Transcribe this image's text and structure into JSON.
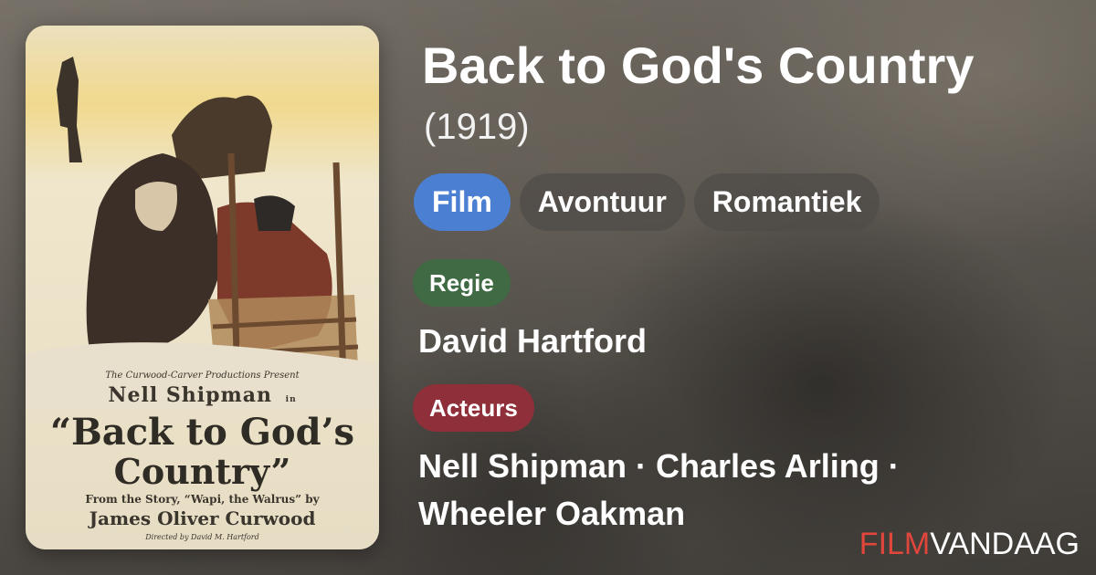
{
  "movie": {
    "title": "Back to God's Country",
    "year": "(1919)"
  },
  "genres": [
    "Film",
    "Avontuur",
    "Romantiek"
  ],
  "director": {
    "label": "Regie",
    "name": "David Hartford"
  },
  "actors": {
    "label": "Acteurs",
    "names_line1": "Nell Shipman · Charles Arling ·",
    "names_line2": "Wheeler Oakman"
  },
  "brand": {
    "part1": "FILM",
    "part2": "VANDAAG"
  },
  "poster": {
    "presents": "The Curwood-Carver Productions Present",
    "star": "Nell Shipman",
    "star_in": "in",
    "title_line1": "“Back to God’s",
    "title_line2": "Country”",
    "story": "From the Story, “Wapi, the Walrus” by",
    "author": "James Oliver Curwood",
    "director_credit": "Directed by David M. Hartford"
  },
  "colors": {
    "genre_primary": "#4a7fd2",
    "genre_other": "#504c48",
    "director_label": "#3f6a43",
    "actors_label": "#8e2f39",
    "brand_accent": "#e0463b"
  }
}
